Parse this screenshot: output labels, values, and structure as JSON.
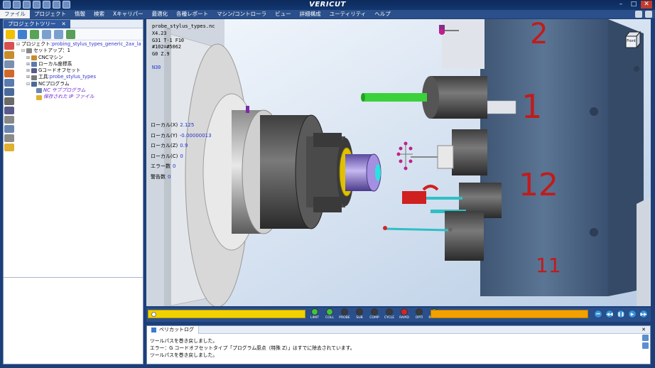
{
  "app": {
    "title": "VERICUT"
  },
  "menu": {
    "items": [
      "ファイル",
      "プロジェクト",
      "情報",
      "検索",
      "Xキャリパー",
      "最適化",
      "各種レポート",
      "マシン/コントローラ",
      "ビュー",
      "詳細構成",
      "ユーティリティ",
      "ヘルプ"
    ],
    "active_index": 0
  },
  "project_tree": {
    "tab_label": "プロジェクトツリー",
    "close_glyph": "✕",
    "rows": [
      {
        "exp": "⊟",
        "icon": "folder",
        "label": "プロジェクト",
        "value": ":probing_stylus_types_generic_2ax_lathe_fan1ft_in",
        "indent": 0
      },
      {
        "exp": "⊟",
        "icon": "setup",
        "label": "セットアップ：1",
        "value": "",
        "indent": 1
      },
      {
        "exp": "⊞",
        "icon": "machine",
        "label": "CNCマシン",
        "value": "",
        "indent": 2
      },
      {
        "exp": "⊞",
        "icon": "coord",
        "label": "ローカル座標系",
        "value": "",
        "indent": 2
      },
      {
        "exp": "⊞",
        "icon": "gcode",
        "label": "Gコードオフセット",
        "value": "",
        "indent": 2
      },
      {
        "exp": "⊞",
        "icon": "tool",
        "label": "工具",
        "value": ":probe_stylus_types",
        "indent": 2
      },
      {
        "exp": "⊟",
        "icon": "nc",
        "label": "NCプログラム",
        "value": "",
        "indent": 2
      },
      {
        "exp": "",
        "icon": "nc2",
        "label": "",
        "value": "NC サブプログラム",
        "indent": 3,
        "style": "blue"
      },
      {
        "exp": "",
        "icon": "file",
        "label": "",
        "value": "保存された IP ファイル",
        "indent": 3,
        "style": "blue"
      }
    ]
  },
  "viewport": {
    "filename": "probe_stylus_types.nc",
    "nc_lines": [
      "X4.23",
      "G31 T-1 F10",
      "#102=#5062",
      "G0 Z.9",
      "",
      "N30"
    ],
    "current_line_index": 5,
    "locals": [
      {
        "label": "ローカル(X)",
        "value": "2.125"
      },
      {
        "label": "ローカル(Y)",
        "value": "-0.00000013"
      },
      {
        "label": "ローカル(Z)",
        "value": "0.9"
      },
      {
        "label": "ローカル(C)",
        "value": "0"
      },
      {
        "label": "エラー数",
        "value": "0"
      },
      {
        "label": "警告数",
        "value": "0"
      }
    ],
    "turret_numbers": [
      "2",
      "1",
      "12",
      "11"
    ],
    "viewcube_label": "Front"
  },
  "playbar": {
    "leds": [
      {
        "label": "LIMIT",
        "color": "#3ec43e"
      },
      {
        "label": "COLL",
        "color": "#3ec43e"
      },
      {
        "label": "PROBE",
        "color": "#3a3a3a"
      },
      {
        "label": "SUB",
        "color": "#3a3a3a"
      },
      {
        "label": "COMP",
        "color": "#3a3a3a"
      },
      {
        "label": "CYCLE",
        "color": "#3a3a3a"
      },
      {
        "label": "RAPID",
        "color": "#d62424"
      },
      {
        "label": "OPTI",
        "color": "#3a3a3a"
      },
      {
        "label": "READY",
        "color": "#3ec43e"
      }
    ],
    "buttons": [
      "⏮",
      "◀◀",
      "❚❚",
      "▶",
      "▶▶"
    ]
  },
  "log": {
    "tab_label": "ベリカットログ",
    "close_glyph": "✕",
    "lines": [
      "ツールパスを巻き戻しました。",
      "エラー：G コードオフセットタイプ「プログラム原点（特殊 Z）」はすでに除去されています。",
      "ツールパスを巻き戻しました。"
    ]
  },
  "colors": {
    "accent": "#2a4f8a",
    "turret": "#4f6683",
    "number_red": "#c21b1b",
    "probe_cyan": "#2fbfc4",
    "green_rod": "#3ad13a"
  }
}
